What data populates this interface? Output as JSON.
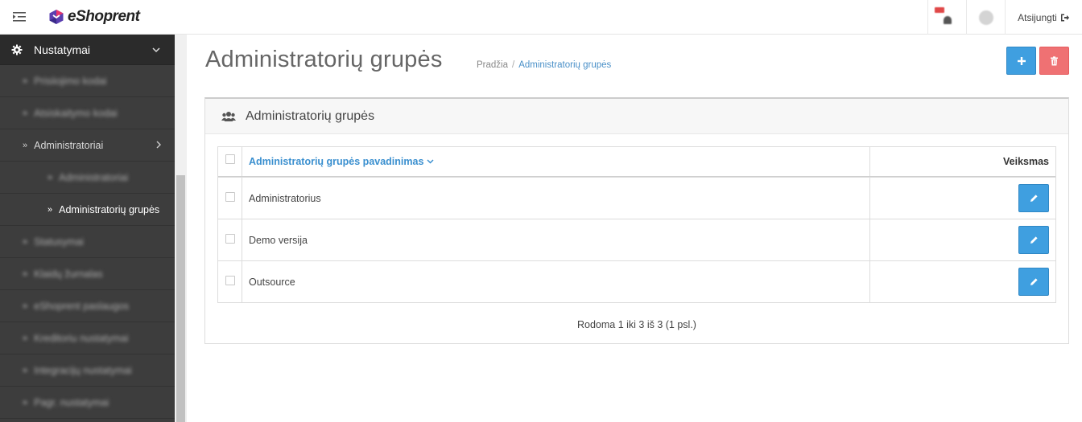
{
  "header": {
    "brand": "eShoprent",
    "logout_label": "Atsijungti"
  },
  "sidebar": {
    "section_label": "Nustatymai",
    "items": [
      {
        "label": "Prisiiojimo kodai",
        "blurred": true
      },
      {
        "label": "Atsiskaitymo kodai",
        "blurred": true
      },
      {
        "label": "Administratoriai",
        "blurred": false
      },
      {
        "label": "Administratoriai",
        "blurred": true
      },
      {
        "label": "Administratorių grupės",
        "blurred": false
      },
      {
        "label": "Statusymai",
        "blurred": true
      },
      {
        "label": "Klaidų žurnalas",
        "blurred": true
      },
      {
        "label": "eShoprent paslaugos",
        "blurred": true
      },
      {
        "label": "Kreditoriu nustatymai",
        "blurred": true
      },
      {
        "label": "Integracijų nustatymai",
        "blurred": true
      },
      {
        "label": "Pagr. nustatymai",
        "blurred": true
      }
    ]
  },
  "page": {
    "title": "Administratorių grupės",
    "breadcrumb": [
      "Pradžia",
      "Administratorių grupės"
    ]
  },
  "panel": {
    "title": "Administratorių grupės",
    "columns": {
      "name": "Administratorių grupės pavadinimas",
      "actions": "Veiksmas"
    },
    "rows": [
      {
        "name": "Administratorius"
      },
      {
        "name": "Demo versija"
      },
      {
        "name": "Outsource"
      }
    ],
    "pager": "Rodoma 1 iki 3 iš 3 (1 psl.)"
  },
  "colors": {
    "primary": "#3f9fe0",
    "danger": "#ef7173",
    "sidebar": "#3d3d3d",
    "link": "#3a8fcf"
  },
  "icons": {
    "menu": "hamburger-collapse-icon",
    "settings": "gear-icon",
    "add": "plus-icon",
    "delete": "trash-icon",
    "edit": "pencil-icon",
    "group": "users-icon",
    "logout": "sign-out-icon"
  }
}
